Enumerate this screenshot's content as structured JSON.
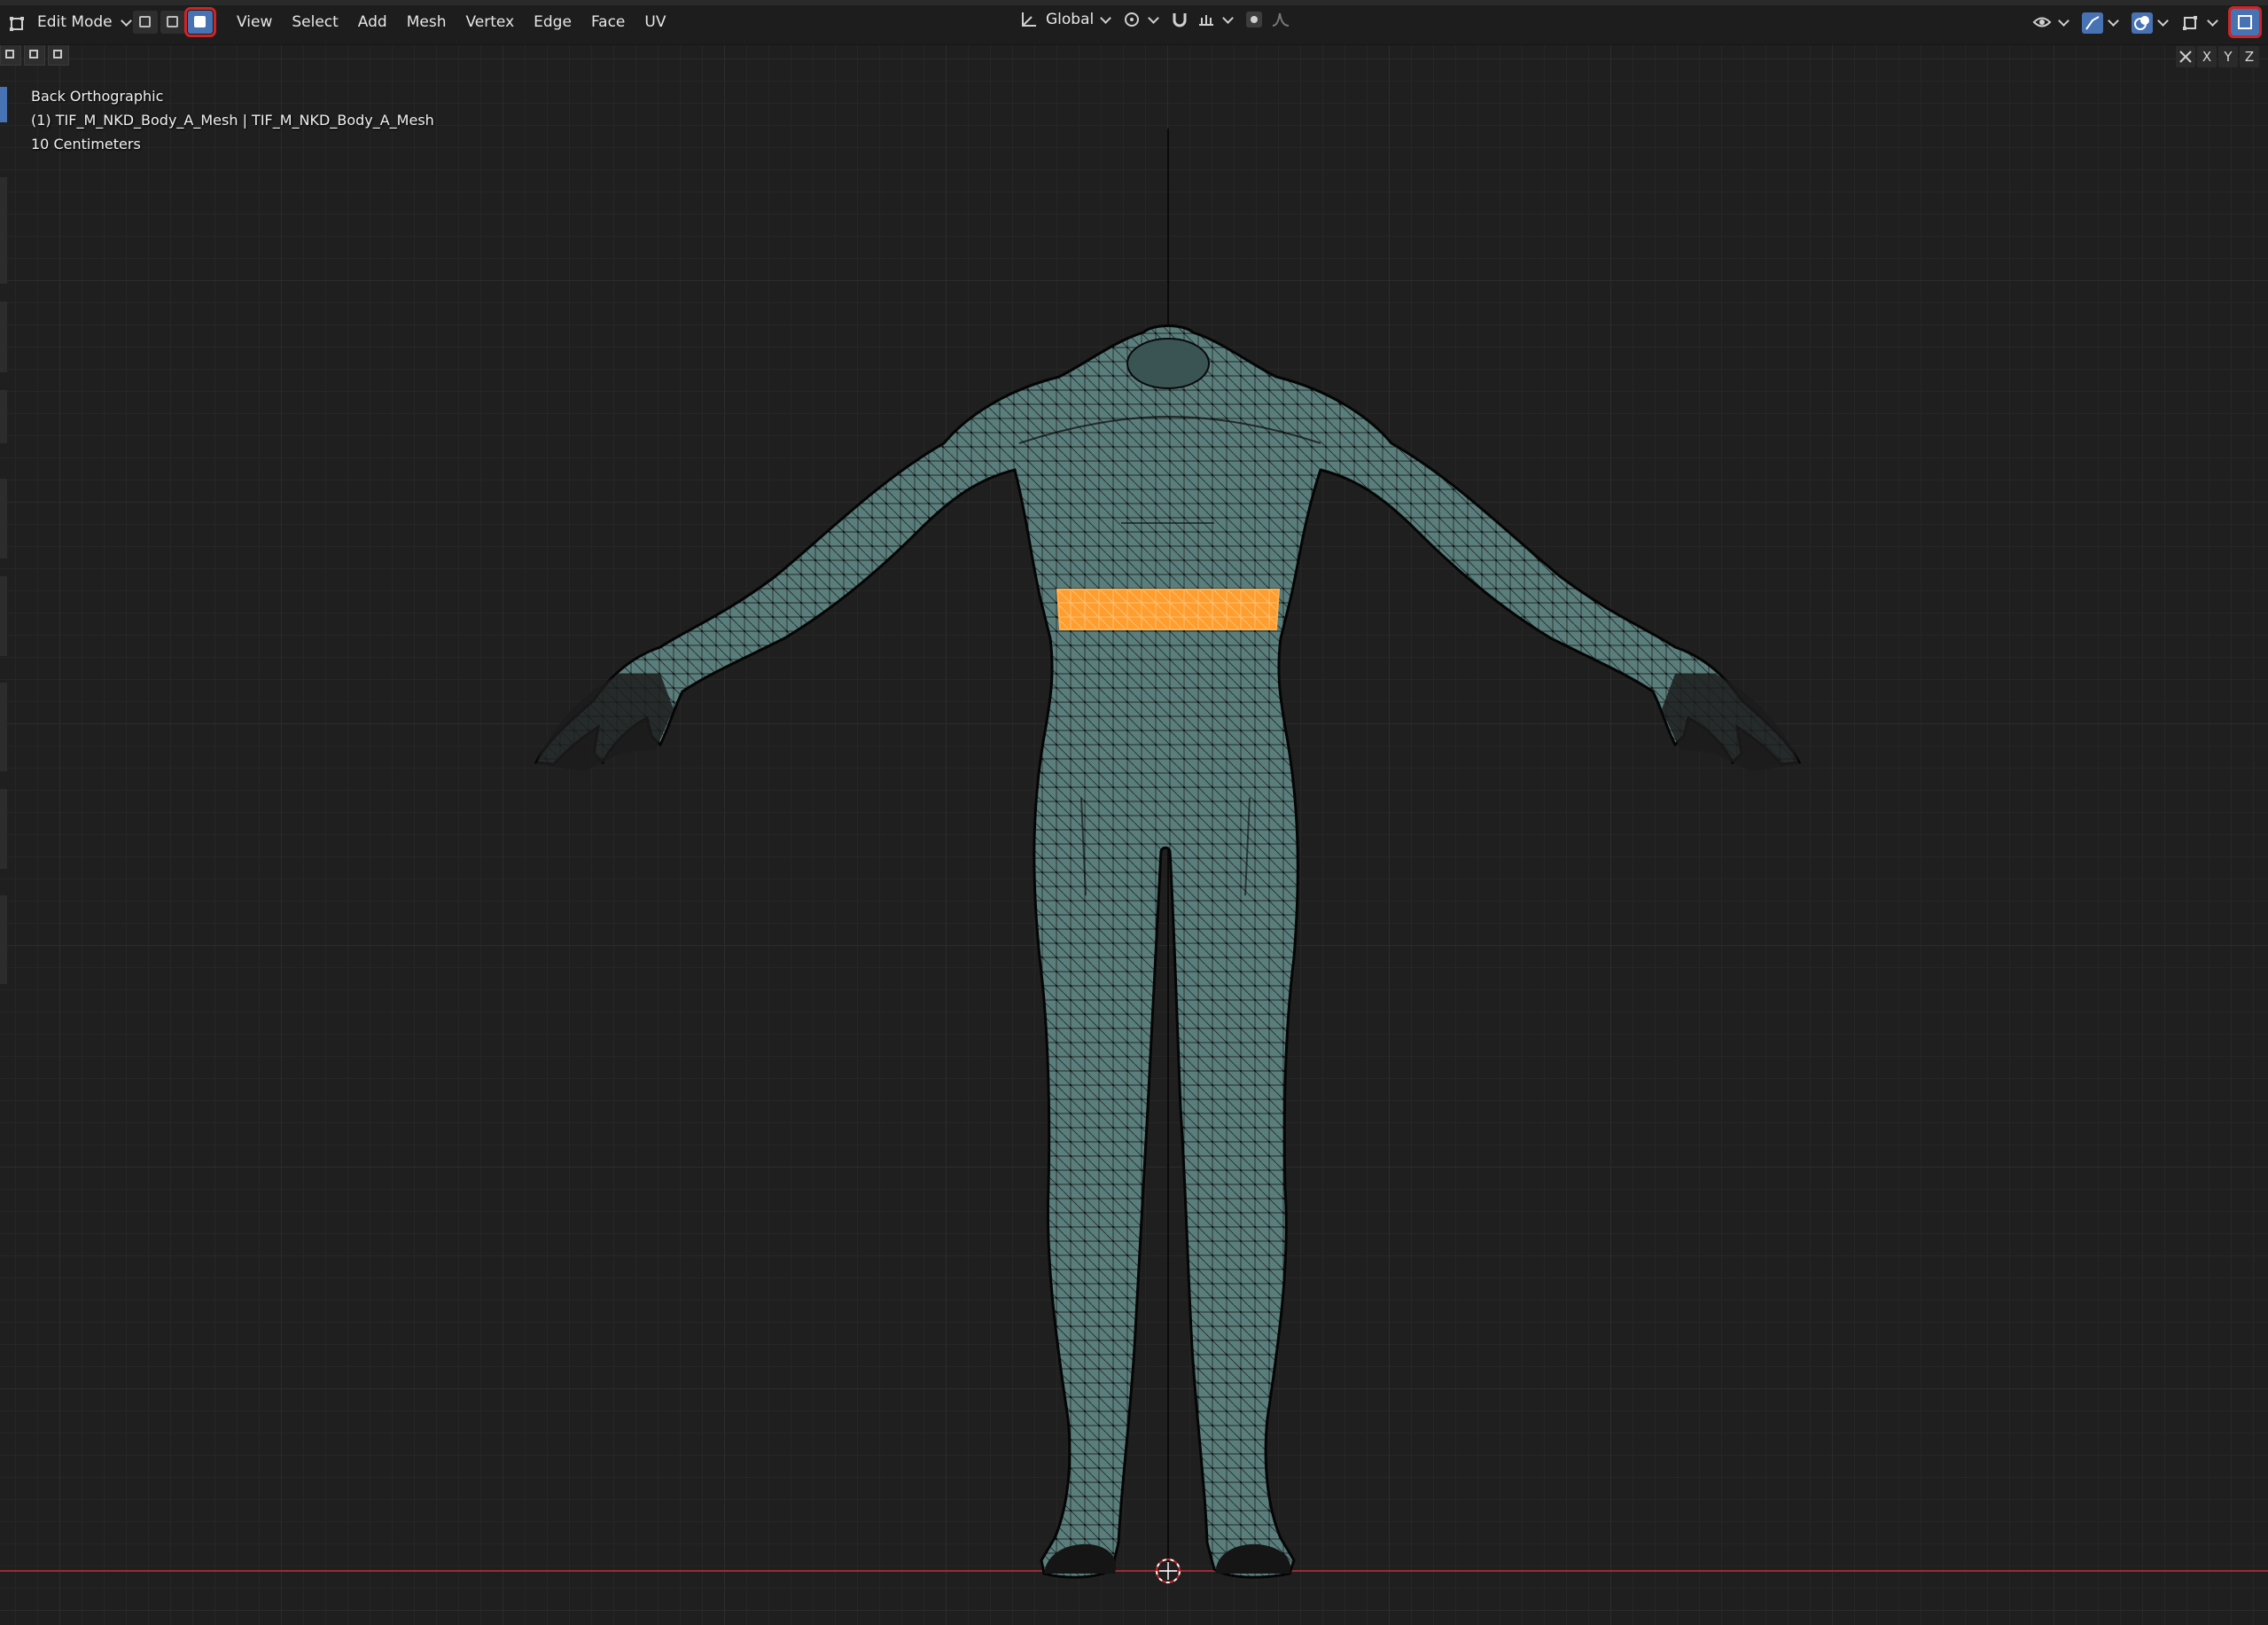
{
  "header": {
    "mode_label": "Edit Mode",
    "select_modes": [
      "vertex-select",
      "edge-select",
      "face-select"
    ],
    "active_select_mode": "face-select",
    "menus": [
      "View",
      "Select",
      "Add",
      "Mesh",
      "Vertex",
      "Edge",
      "Face",
      "UV"
    ],
    "transform_orientation": "Global",
    "xray_active": true
  },
  "viewport": {
    "view_name": "Back Orthographic",
    "object_name": "(1) TIF_M_NKD_Body_A_Mesh | TIF_M_NKD_Body_A_Mesh",
    "grid_scale": "10 Centimeters",
    "axis_buttons": [
      "X",
      "Y",
      "Z"
    ]
  },
  "colors": {
    "header_bg": "#1d1d1d",
    "viewport_bg": "#1f1f1f",
    "grid_line": "#2c2c2c",
    "mesh_fill": "#5a7e7c",
    "mesh_wire": "#0b0b0b",
    "selection": "#ffa032",
    "active_button": "#4772b3",
    "highlight_box": "#d02424",
    "x_axis": "#9c2b35"
  }
}
